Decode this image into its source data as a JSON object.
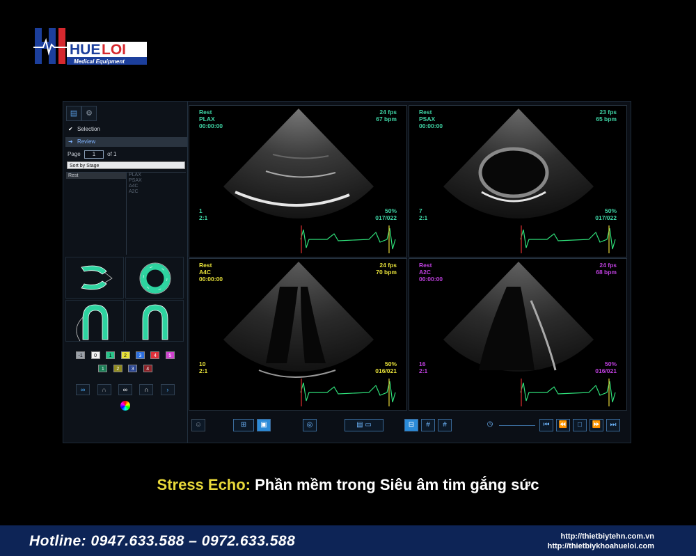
{
  "brand": {
    "logo_text": "HUELOI",
    "logo_sub": "Medical Equipment"
  },
  "panel": {
    "selection_label": "Selection",
    "review_label": "Review",
    "page_label": "Page",
    "page_value": "1",
    "page_of": "of 1",
    "sort_label": "Sort by Stage",
    "stages": [
      "Rest"
    ],
    "views": [
      "PLAX",
      "PSAX",
      "A4C",
      "A2C"
    ],
    "segment_numbers_row1": [
      "-1",
      "0",
      "1",
      "2",
      "3",
      "4",
      "5"
    ],
    "segment_numbers_row2": [
      "1",
      "2",
      "3",
      "4"
    ]
  },
  "quadrants": [
    {
      "stage": "Rest",
      "view": "PLAX",
      "time": "00:00:00",
      "fps": "24 fps",
      "bpm": "67 bpm",
      "clip": "1",
      "ratio": "2:1",
      "percent": "50%",
      "frames": "017/022",
      "color": "#3fd6a6",
      "stage_color": "#3fd6a6"
    },
    {
      "stage": "Rest",
      "view": "PSAX",
      "time": "00:00:00",
      "fps": "23 fps",
      "bpm": "65 bpm",
      "clip": "7",
      "ratio": "2:1",
      "percent": "50%",
      "frames": "017/022",
      "color": "#3fd6a6",
      "stage_color": "#3fd6a6"
    },
    {
      "stage": "Rest",
      "view": "A4C",
      "time": "00:00:00",
      "fps": "24 fps",
      "bpm": "70 bpm",
      "clip": "10",
      "ratio": "2:1",
      "percent": "50%",
      "frames": "016/021",
      "color": "#e8e23a",
      "stage_color": "#e8e23a"
    },
    {
      "stage": "Rest",
      "view": "A2C",
      "time": "00:00:00",
      "fps": "24 fps",
      "bpm": "68 bpm",
      "clip": "16",
      "ratio": "2:1",
      "percent": "50%",
      "frames": "016/021",
      "color": "#c040e0",
      "stage_color": "#c040e0"
    }
  ],
  "caption": {
    "highlight": "Stress Echo:",
    "rest": " Phần mềm trong Siêu âm tim gắng sức"
  },
  "footer": {
    "hotline": "Hotline: 0947.633.588 – 0972.633.588",
    "url1": "http://thietbiytehn.com.vn",
    "url2": "http://thietbiykhoahueloi.com"
  },
  "colors": {
    "accent_blue": "#2b8bd8",
    "segment_green": "#2ed3a0",
    "ecg_green": "#2fe07a",
    "footer_bg": "#0d2456",
    "caption_yellow": "#e8d83a"
  },
  "icons": [
    "doc-icon",
    "gear-icon",
    "check-icon",
    "arrow-right-icon",
    "clock-icon",
    "first-frame-icon",
    "prev-frame-icon",
    "stop-icon",
    "next-frame-icon",
    "last-frame-icon"
  ]
}
